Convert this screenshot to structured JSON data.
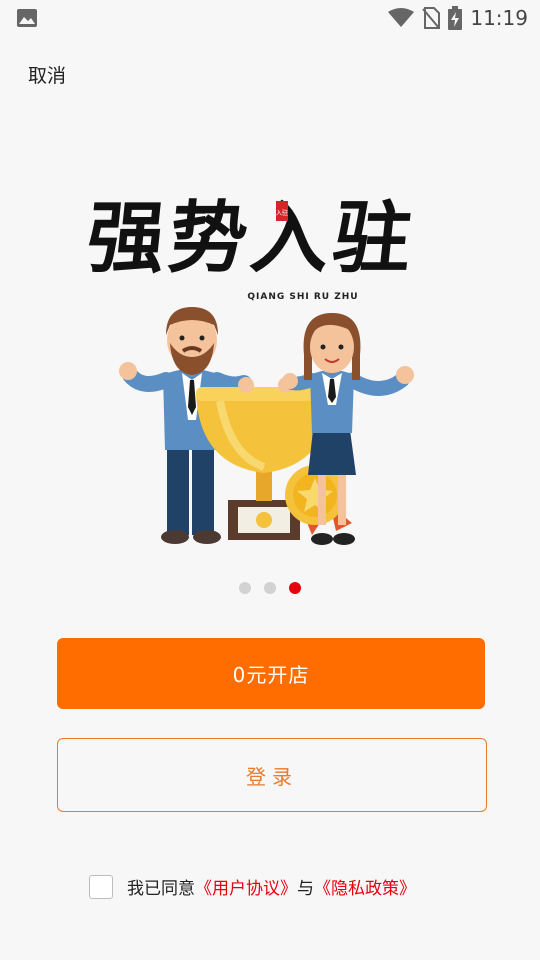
{
  "status_bar": {
    "time": "11:19",
    "icons": [
      "image-icon",
      "wifi-icon",
      "no-sim-icon",
      "battery-charging-icon"
    ]
  },
  "header": {
    "cancel_label": "取消"
  },
  "banner": {
    "title": "强势入驻",
    "subtitle": "QIANG SHI RU ZHU",
    "seal_text": "入驻"
  },
  "carousel": {
    "total": 3,
    "active_index": 2
  },
  "buttons": {
    "open_store_label": "0元开店",
    "login_label": "登录"
  },
  "agreement": {
    "checked": false,
    "prefix": "我已同意",
    "user_agreement": "《用户协议》",
    "conjunction": "与",
    "privacy_policy": "《隐私政策》"
  },
  "colors": {
    "primary": "#ff6d00",
    "login_border": "#e97a2c",
    "link": "#e8000c",
    "active_dot": "#e8000c",
    "inactive_dot": "#d2d2d2",
    "background": "#f7f7f7"
  }
}
